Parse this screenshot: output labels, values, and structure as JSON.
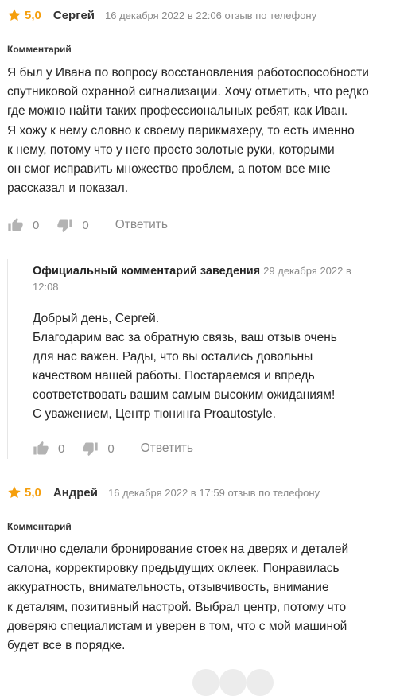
{
  "colors": {
    "star": "#f59e0b",
    "muted": "#8a8a8a",
    "text": "#262626"
  },
  "reviews": [
    {
      "rating": "5,0",
      "author": "Сергей",
      "meta": "16 декабря 2022 в 22:06 отзыв по телефону",
      "comment_label": "Комментарий",
      "lines": [
        "Я был у Ивана по вопросу восстановления работоспособности",
        "спутниковой охранной сигнализации. Хочу отметить, что редко",
        "где можно найти таких профессиональных ребят, как Иван.",
        "Я хожу к нему словно к своему парикмахеру, то есть именно",
        "к нему, потому что у него просто золотые руки, которыми",
        "он смог исправить множество проблем, а потом все мне",
        "рассказал и показал."
      ],
      "likes": "0",
      "dislikes": "0",
      "reply_label": "Ответить",
      "official": {
        "title": "Официальный комментарий заведения",
        "date_line1": "29 декабря 2022 в",
        "date_line2": "12:08",
        "lines": [
          "Добрый день, Сергей.",
          "Благодарим вас за обратную связь, ваш отзыв очень",
          "для нас важен. Рады, что вы остались довольны",
          "качеством нашей работы. Постараемся и впредь",
          "соответствовать вашим самым высоким ожиданиям!",
          "С уважением, Центр тюнинга Proautostyle."
        ],
        "likes": "0",
        "dislikes": "0",
        "reply_label": "Ответить"
      }
    },
    {
      "rating": "5,0",
      "author": "Андрей",
      "meta": "16 декабря 2022 в 17:59 отзыв по телефону",
      "comment_label": "Комментарий",
      "lines": [
        "Отлично сделали бронирование стоек на дверях и деталей",
        "салона, корректировку предыдущих оклеек. Понравилась",
        "аккуратность, внимательность, отзывчивость, внимание",
        "к деталям, позитивный настрой. Выбрал центр, потому что",
        "доверяю специалистам и уверен в том, что с мой машиной",
        "будет все в порядке."
      ]
    }
  ]
}
